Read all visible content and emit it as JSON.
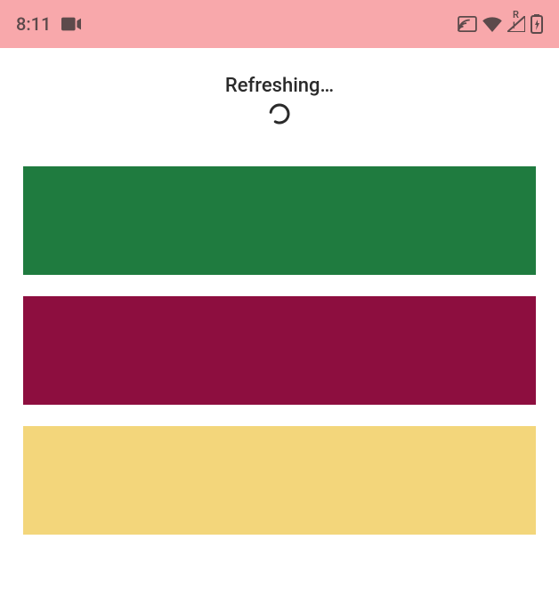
{
  "status_bar": {
    "time": "8:11",
    "bg_color": "#f8a8ab",
    "icon_color": "#5c4a4b",
    "left_icons": [
      {
        "name": "videocam-icon"
      }
    ],
    "right_icons": [
      {
        "name": "cast-icon"
      },
      {
        "name": "wifi-icon"
      },
      {
        "name": "signal-roaming-icon",
        "badge": "R"
      },
      {
        "name": "battery-charging-icon"
      }
    ]
  },
  "refresh": {
    "label": "Refreshing…"
  },
  "items": [
    {
      "color": "#1f7b3f"
    },
    {
      "color": "#8d0e3f"
    },
    {
      "color": "#f3d67b"
    }
  ]
}
